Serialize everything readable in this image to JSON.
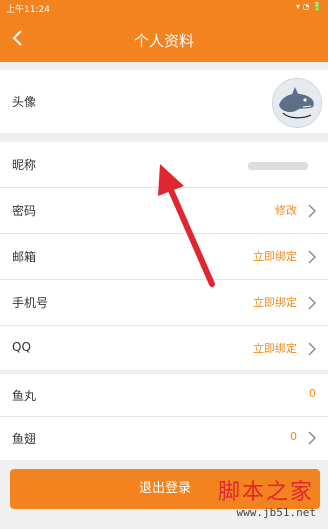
{
  "status": {
    "time": "上午11:24",
    "icons": "▾ ◔ 🔋"
  },
  "header": {
    "title": "个人资料"
  },
  "section1": {
    "avatar_label": "头像"
  },
  "section2": {
    "nickname_label": "昵称",
    "password_label": "密码",
    "password_action": "修改",
    "email_label": "邮箱",
    "email_action": "立即绑定",
    "phone_label": "手机号",
    "phone_action": "立即绑定",
    "qq_label": "QQ",
    "qq_action": "立即绑定"
  },
  "section3": {
    "fish_ball_label": "鱼丸",
    "fish_ball_value": "0",
    "fish_fin_label": "鱼翅",
    "fish_fin_value": "0"
  },
  "logout_label": "退出登录",
  "watermark": {
    "text_cn": "脚本之家",
    "url": "www.jb51.net"
  },
  "colors": {
    "accent": "#f2831f",
    "annotation": "#e0262f"
  }
}
